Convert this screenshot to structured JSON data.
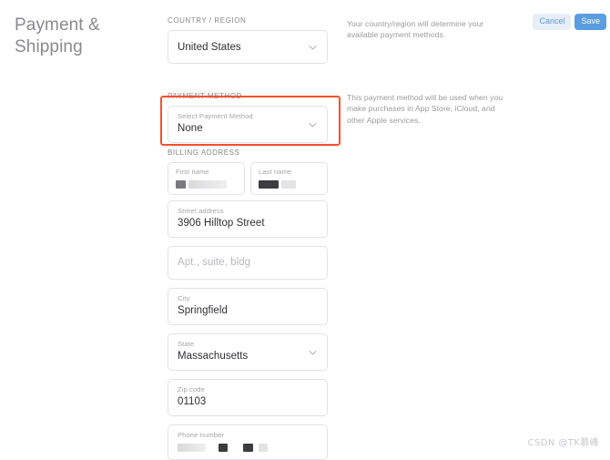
{
  "page": {
    "title": "Payment &\nShipping",
    "title_line1": "Payment &",
    "title_line2": "Shipping",
    "background": "#ffffff",
    "highlight_color": "#f9502a"
  },
  "actions": {
    "cancel_label": "Cancel",
    "save_label": "Save",
    "cancel_bg": "#e7eef7",
    "cancel_fg": "#5b9ae0",
    "save_bg": "#5a9de0",
    "save_fg": "#ffffff"
  },
  "sections": {
    "country": {
      "label": "COUNTRY / REGION",
      "field_value": "United States",
      "help_text": "Your country/region will determine your available payment methods."
    },
    "payment": {
      "label": "PAYMENT METHOD",
      "field_label": "Select Payment Method",
      "field_value": "None",
      "help_text": "This payment method will be used when you make purchases in App Store, iCloud, and other Apple services.",
      "highlighted": true
    },
    "billing": {
      "label": "BILLING ADDRESS",
      "first_name": {
        "label": "First name",
        "value": "",
        "redacted": true
      },
      "last_name": {
        "label": "Last name",
        "value": "",
        "redacted": true
      },
      "street": {
        "label": "Street address",
        "value": "3906 Hilltop Street"
      },
      "apt": {
        "label": "",
        "placeholder": "Apt., suite, bldg",
        "value": ""
      },
      "city": {
        "label": "City",
        "value": "Springfield"
      },
      "state": {
        "label": "State",
        "value": "Massachusetts"
      },
      "zip": {
        "label": "Zip code",
        "value": "01103"
      },
      "phone": {
        "label": "Phone number",
        "value": "",
        "redacted": true
      }
    }
  },
  "watermark": "CSDN @TK慕峰"
}
